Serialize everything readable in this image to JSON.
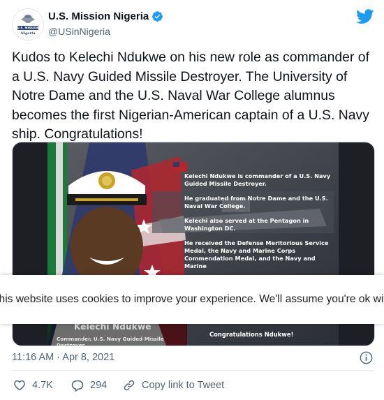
{
  "tweet": {
    "display_name": "U.S. Mission Nigeria",
    "handle": "@USinNigeria",
    "avatar_text": [
      "U.S. MISSION",
      "Nigeria"
    ],
    "text": "Kudos to Kelechi Ndukwe on his new role as commander of a U.S. Navy Guided Missile Destroyer. The University of Notre Dame and the U.S. Naval War College alumnus becomes the first Nigerian-American captain of a U.S. Navy ship. Congratulations!",
    "timestamp": "11:16 AM · Apr 8, 2021"
  },
  "media": {
    "lines": [
      "Kelechi Ndukwe is commander of a U.S. Navy Guided Missile Destroyer.",
      "He graduated from Notre Dame and the U.S. Naval War College.",
      "Kelechi also served at the Pentagon in Washington DC.",
      "He received the Defense Meritorious Service Medal, the Navy and Marine Corps Commendation Medal, and the Navy and Marine"
    ],
    "nameplate_name": "Kelechi Ndukwe",
    "nameplate_title": "Commander, U.S. Navy Guided Missile Destroyer",
    "congrats": "Congratulations Ndukwe!"
  },
  "cookie_banner": {
    "text": "This website uses cookies to improve your experience. We'll assume you're ok with this"
  },
  "actions": {
    "likes": "4.7K",
    "replies": "294",
    "copy_link": "Copy link to Tweet"
  },
  "icons": {
    "verified": "verified-badge-icon",
    "bird": "twitter-bird-icon",
    "info": "info-icon",
    "like": "heart-icon",
    "reply": "reply-icon",
    "copy": "link-icon"
  },
  "colors": {
    "twitter_blue": "#1d9bf0",
    "secondary_text": "#536471",
    "primary_text": "#0f1419"
  }
}
